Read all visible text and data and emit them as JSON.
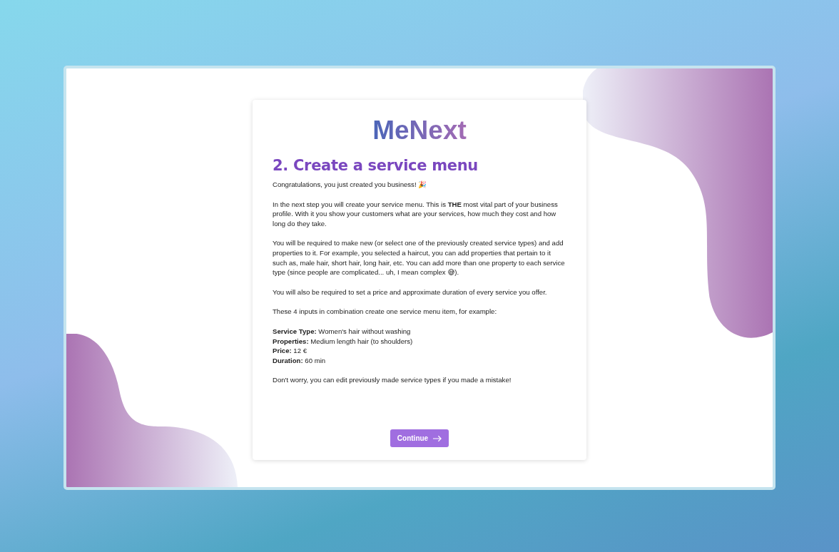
{
  "logo": "MeNext",
  "heading": "2. Create a service menu",
  "paragraphs": [
    "Congratulations, you just created you business! 🎉",
    "In the next step you will create your service menu. This is **THE** most vital part of your business profile. With it you show your customers what are your services, how much they cost and how long do they take.",
    "You will be required to make new (or select one of the previously created service types) and add properties to it. For example, you selected a haircut, you can add properties that pertain to it such as, male hair, short hair, long hair, etc. You can add more than one property to each service type (since people are complicated... uh, I mean complex 😅).",
    "You will also be required to set a price and approximate duration of every service you offer.",
    "These 4 inputs in combination create one service menu item, for example:"
  ],
  "example": [
    "**Service Type:** Women's hair without washing",
    "**Properties:** Medium length hair (to shoulders)",
    "**Price:** 12 €",
    "**Duration:** 60 min"
  ],
  "note": "Don't worry, you can edit previously made service types if you made a mistake!",
  "button": {
    "label": "Continue"
  }
}
